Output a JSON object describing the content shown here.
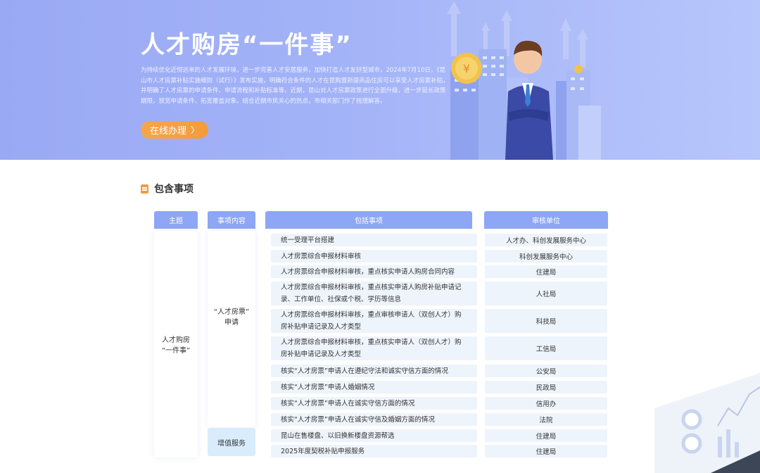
{
  "banner": {
    "title": "人才购房“一件事”",
    "description": "为持续优化近悦远来的人才发展环境，进一步完善人才安居服务，加快打造人才友好型城市，2024年7月10日，《昆山市人才房票补贴实施细则（试行）》发布实施，明确符合条件的人才在昆购置新建商品住房可以享受人才房票补贴，并明确了人才房票的申请条件、申请流程和补贴标准等。近期，昆山对人才房票政策进行全面升级，进一步延长政策期限，放宽申请条件、拓宽覆盖对象。结合近期市民关心的热点，市相关部门作了梳理解答。",
    "button_label": "在线办理",
    "button_chevron": "〉",
    "coin_symbol": "¥"
  },
  "section": {
    "title": "包含事项"
  },
  "table": {
    "headers": {
      "theme": "主题",
      "content": "事项内容",
      "items": "包括事项",
      "unit": "审核单位"
    },
    "theme_value": "人才购房\n“一件事”",
    "content_values": {
      "apply": "“人才房票”\n申请",
      "value_added": "增值服务"
    },
    "rows": [
      {
        "item": "统一受理平台搭建",
        "unit": "人才办、科创发展服务中心"
      },
      {
        "item": "人才房票综合申报材料审核",
        "unit": "科创发展服务中心"
      },
      {
        "item": "人才房票综合申报材料审核，重点核实申请人购房合同内容",
        "unit": "住建局"
      },
      {
        "item": "人才房票综合申报材料审核，重点核实申请人购房补贴申请记录、工作单位、社保或个税、学历等信息",
        "unit": "人社局"
      },
      {
        "item": "人才房票综合申报材料审核，重点审核申请人（双创人才）购房补贴申请记录及人才类型",
        "unit": "科技局"
      },
      {
        "item": "人才房票综合申报材料审核，重点核实申请人（双创人才）购房补贴申请记录及人才类型",
        "unit": "工信局"
      },
      {
        "item": "核实“人才房票”申请人在遵纪守法和诚实守信方面的情况",
        "unit": "公安局"
      },
      {
        "item": "核实“人才房票”申请人婚姻情况",
        "unit": "民政局"
      },
      {
        "item": "核实“人才房票”申请人在诚实守信方面的情况",
        "unit": "信用办"
      },
      {
        "item": "核实“人才房票”申请人在诚实守信及婚姻方面的情况",
        "unit": "法院"
      },
      {
        "item": "昆山在售楼盘、以旧换新楼盘资源帮选",
        "unit": "住建局"
      },
      {
        "item": "2025年度契税补贴申报服务",
        "unit": "住建局"
      }
    ]
  },
  "colors": {
    "banner": "#9aa9f4",
    "header": "#8da6f5",
    "row_bg": "#eef4fb",
    "accent": "#f59a3a"
  }
}
